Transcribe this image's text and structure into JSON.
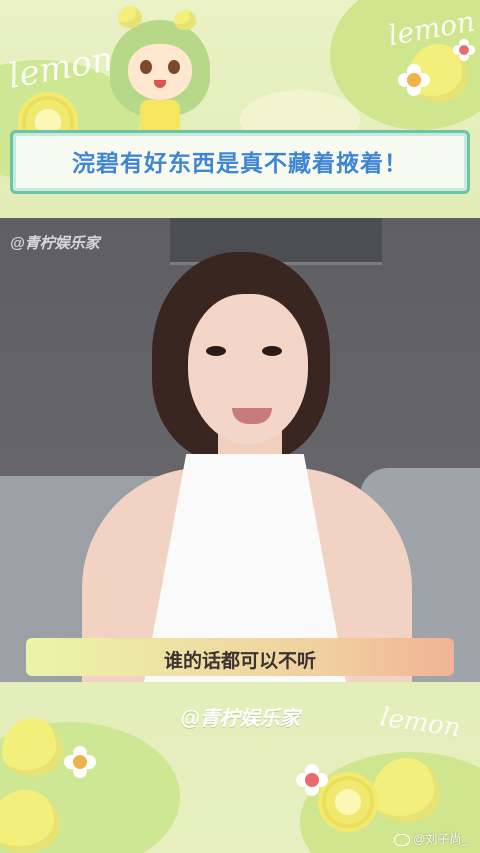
{
  "top_banner": {
    "decor_text_left": "lemon",
    "decor_text_right": "lemon",
    "title": "浣碧有好东西是真不藏着掖着！"
  },
  "video": {
    "watermark": "@青柠娱乐家",
    "subtitle": "谁的话都可以不听"
  },
  "bottom_banner": {
    "channel_name": "@青柠娱乐家",
    "decor_text": "lemon",
    "credit": "@刘子尚_"
  },
  "colors": {
    "title_text": "#3f86d2",
    "title_border": "#6cc3a5",
    "banner_bg": "#e7efc0",
    "subtitle_gradient_start": "#eaf5a9",
    "subtitle_gradient_end": "#f0b395"
  },
  "icons": {
    "credit_icon": "weibo-icon"
  }
}
